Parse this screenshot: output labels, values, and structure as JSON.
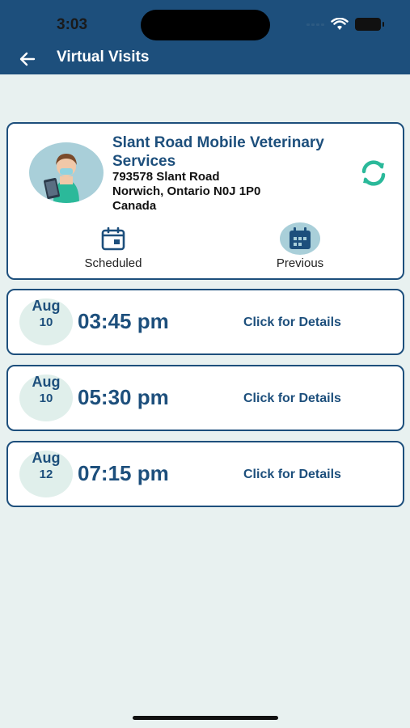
{
  "status_bar": {
    "time": "3:03"
  },
  "header": {
    "title": "Virtual Visits"
  },
  "provider": {
    "name": "Slant Road Mobile Veterinary Services",
    "address_line1": "793578 Slant Road",
    "address_line2": "Norwich, Ontario N0J 1P0",
    "address_line3": "Canada"
  },
  "tabs": [
    {
      "label": "Scheduled",
      "icon": "calendar-icon",
      "active": false
    },
    {
      "label": "Previous",
      "icon": "calendar-grid-icon",
      "active": true
    }
  ],
  "visits": [
    {
      "month": "Aug",
      "day": "10",
      "time": "03:45 pm",
      "action": "Click for Details"
    },
    {
      "month": "Aug",
      "day": "10",
      "time": "05:30 pm",
      "action": "Click for Details"
    },
    {
      "month": "Aug",
      "day": "12",
      "time": "07:15 pm",
      "action": "Click for Details"
    }
  ],
  "colors": {
    "primary": "#1d4f7c",
    "accent": "#2bb99a",
    "background": "#e8f1f0"
  }
}
